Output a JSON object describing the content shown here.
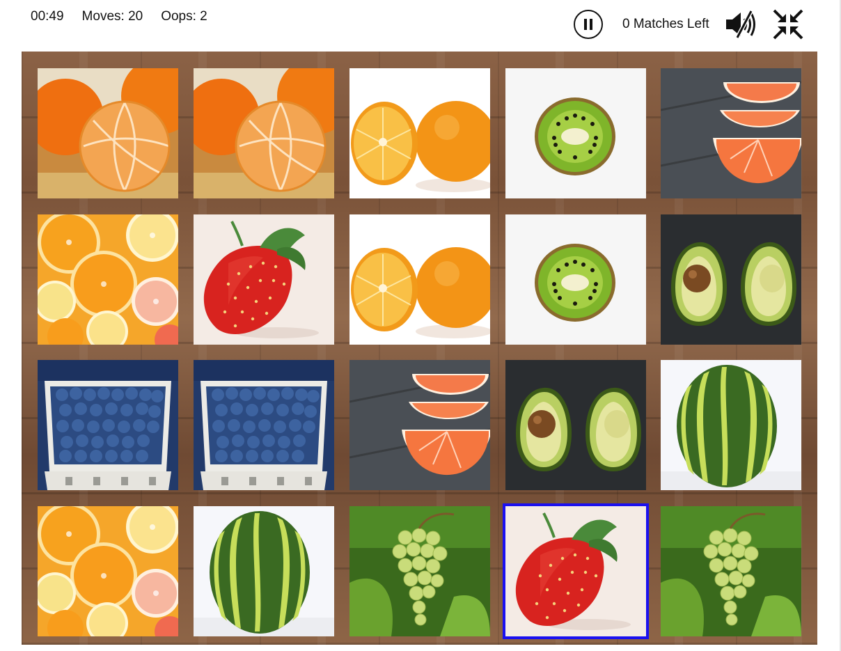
{
  "hud": {
    "timer": "00:49",
    "moves": "Moves: 20",
    "oops": "Oops: 2",
    "matches_left": "0 Matches Left"
  },
  "icons": {
    "pause": "pause-icon",
    "sound": "sound-muted-icon",
    "fullscreen": "exit-fullscreen-icon"
  },
  "colors": {
    "selection": "#1a10f0",
    "board": "#7f573c"
  },
  "board": {
    "rows": [
      [
        "tangerine",
        "tangerine",
        "orange",
        "kiwi",
        "grapefruit"
      ],
      [
        "citrus-slices",
        "strawberry",
        "orange",
        "kiwi",
        "avocado"
      ],
      [
        "blueberries",
        "blueberries",
        "grapefruit",
        "avocado",
        "watermelon"
      ],
      [
        "citrus-slices",
        "watermelon",
        "grapes",
        "strawberry",
        "grapes"
      ]
    ],
    "selected": {
      "row": 3,
      "col": 3
    }
  }
}
